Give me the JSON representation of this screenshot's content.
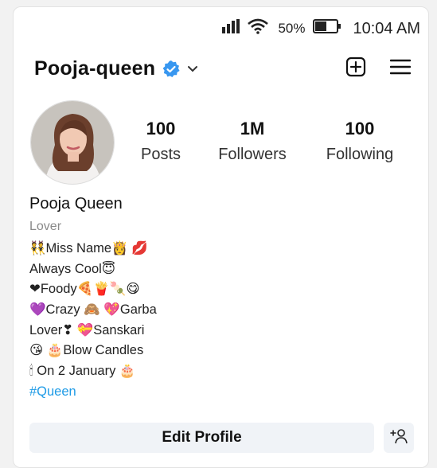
{
  "status_bar": {
    "battery_percent": "50%",
    "time": "10:04 AM",
    "icons": [
      "signal-icon",
      "wifi-icon",
      "battery-icon"
    ]
  },
  "header": {
    "username": "Pooja-queen",
    "verified": true,
    "icons": [
      "verified-badge-icon",
      "chevron-down-icon",
      "create-post-icon",
      "menu-icon"
    ]
  },
  "stats": [
    {
      "value": "100",
      "label": "Posts"
    },
    {
      "value": "1M",
      "label": "Followers"
    },
    {
      "value": "100",
      "label": "Following"
    }
  ],
  "bio": {
    "display_name": "Pooja Queen",
    "category": "Lover",
    "lines": [
      "👯Miss Name👸 💋",
      "Always Cool😇",
      "❤Foody🍕🍟🍡😋",
      "💜Crazy 🙈 💖Garba",
      "Lover❣ 💝Sanskari",
      "😘 🎂Blow Candles",
      "🕯 On 2 January 🎂"
    ],
    "hashtag": "#Queen"
  },
  "actions": {
    "edit_profile_label": "Edit Profile"
  },
  "colors": {
    "verified_blue": "#3897f0",
    "hashtag_blue": "#1f9be6",
    "button_bg": "#f0f3f7"
  }
}
